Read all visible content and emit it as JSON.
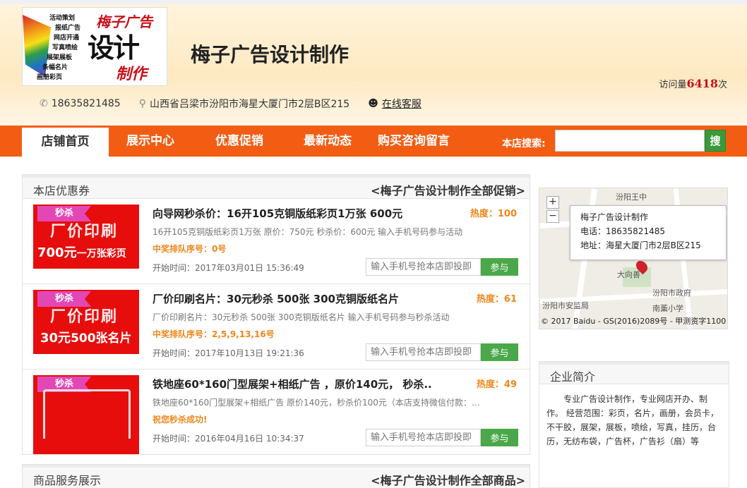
{
  "header": {
    "logo": {
      "services": [
        "活动策划",
        "报纸广告",
        "网店开通",
        "写真喷绘",
        "展架展板",
        "条幅名片",
        "画册彩页"
      ],
      "brand_top": "梅子广告",
      "brand_big": "设计",
      "brand_bottom": "制作"
    },
    "shop_title": "梅子广告设计制作",
    "visits_label": "访问量",
    "visits_count": "6418",
    "visits_unit": "次",
    "phone": "18635821485",
    "address": "山西省吕梁市汾阳市海星大厦门市2层B区215",
    "online_service": "在线客服"
  },
  "nav": {
    "tabs": [
      "店铺首页",
      "展示中心",
      "优惠促销",
      "最新动态",
      "购买咨询留言"
    ],
    "active_index": 0,
    "search_label": "本店搜索:",
    "search_button": "搜"
  },
  "coupons_panel": {
    "title": "本店优惠券",
    "more": "<梅子广告设计制作全部促销>",
    "items": [
      {
        "tag": "秒杀",
        "img_line1": "厂价印刷",
        "img_line2": "700元",
        "img_line2_small": "一万张彩页",
        "title": "向导网秒杀价：16开105克铜版纸彩页1万张 600元",
        "heat": "热度：100",
        "desc": "16开105克铜版纸彩页1万张 原价：750元 秒杀价：600元 输入手机号码参与活动",
        "rank": "中奖排队序号：0号",
        "start": "开始时间：2017年03月01日 15:36:49",
        "phone_placeholder": "输入手机号抢本店即投即",
        "join": "参与"
      },
      {
        "tag": "秒杀",
        "img_line1": "厂价印刷",
        "img_line2": "30元",
        "img_line2_small": "500张名片",
        "title": "厂价印刷名片：30元秒杀 500张 300克铜版纸名片",
        "heat": "热度：61",
        "desc": "厂价印刷名片：30元秒杀 500张 300克铜版纸名片 输入手机号码参与秒杀活动",
        "rank": "中奖排队序号：2,5,9,13,16号",
        "start": "开始时间：2017年10月13日 19:21:36",
        "phone_placeholder": "输入手机号抢本店即投即",
        "join": "参与"
      },
      {
        "tag": "秒杀",
        "img_line1": "",
        "img_line2": "",
        "img_line2_small": "",
        "title": "铁地座60*160门型展架+相纸广告 ，原价140元， 秒杀..",
        "heat": "热度：49",
        "desc": "铁地座60*160门型展架+相纸广告 原价140元，秒杀价100元（本店支持微信付款：1...",
        "rank": "祝您秒杀成功!",
        "start": "开始时间：2016年04月16日 10:34:37",
        "phone_placeholder": "输入手机号抢本店即投即",
        "join": "参与"
      }
    ]
  },
  "products_panel": {
    "title": "商品服务展示",
    "more": "<梅子广告设计制作全部商品>"
  },
  "map": {
    "popup_name": "梅子广告设计制作",
    "popup_phone": "电话：18635821485",
    "popup_address": "地址：海星大厦门市2层B区215",
    "pois": [
      "汾阳市安监局",
      "汾阳市政府",
      "南薰小学",
      "大向善",
      "汾阳王中"
    ],
    "copyright": "© 2017 Baidu - GS(2016)2089号 - 甲测资字1100"
  },
  "intro": {
    "title": "企业简介",
    "text": "专业广告设计制作，专业网店开办、制作。 经营范围：彩页，名片，画册，会员卡，不干胶，展架，展板，喷绘，写真，挂历，台历，无纺布袋，广告杯，广告衫（扇）等"
  },
  "colors": {
    "nav": "#f25d13",
    "heat": "#f0861b",
    "join": "#4aa84a",
    "tag": "#e347b6"
  }
}
